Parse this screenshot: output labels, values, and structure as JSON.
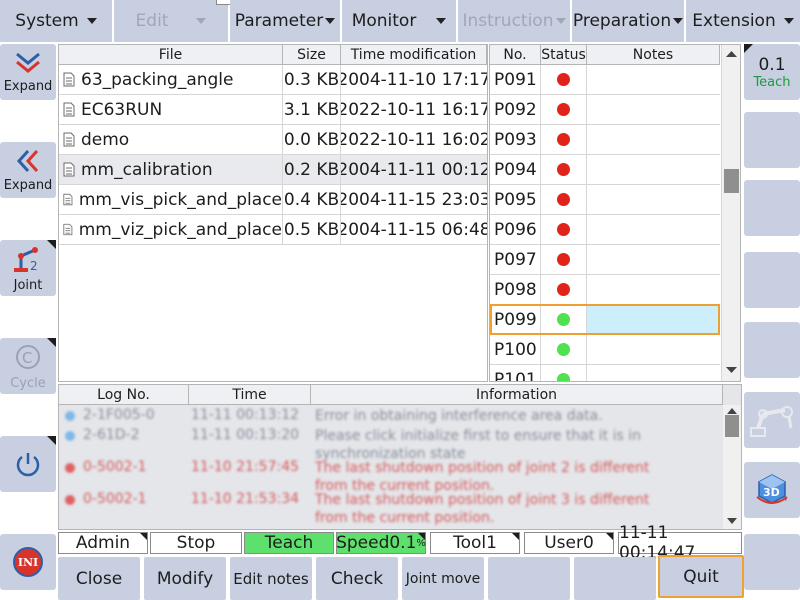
{
  "menu": [
    {
      "label": "System",
      "enabled": true
    },
    {
      "label": "Edit",
      "enabled": false
    },
    {
      "label": "Parameter",
      "enabled": true
    },
    {
      "label": "Monitor",
      "enabled": true
    },
    {
      "label": "Instruction",
      "enabled": false
    },
    {
      "label": "Preparation",
      "enabled": true
    },
    {
      "label": "Extension",
      "enabled": true
    }
  ],
  "left_sidebar": {
    "expand1": "Expand",
    "expand2": "Expand",
    "joint": "Joint",
    "cycle": "Cycle",
    "ini": "INI"
  },
  "files": {
    "headers": {
      "file": "File",
      "size": "Size",
      "time": "Time modification"
    },
    "rows": [
      {
        "name": "63_packing_angle",
        "size": "0.3 KB",
        "time": "2004-11-10 17:17"
      },
      {
        "name": "EC63RUN",
        "size": "3.1 KB",
        "time": "2022-10-11 16:17"
      },
      {
        "name": "demo",
        "size": "0.0 KB",
        "time": "2022-10-11 16:02"
      },
      {
        "name": "mm_calibration",
        "size": "0.2 KB",
        "time": "2004-11-11 00:12"
      },
      {
        "name": "mm_vis_pick_and_place",
        "size": "0.4 KB",
        "time": "2004-11-15 23:03"
      },
      {
        "name": "mm_viz_pick_and_place",
        "size": "0.5 KB",
        "time": "2004-11-15 06:48"
      }
    ]
  },
  "points": {
    "headers": {
      "no": "No.",
      "status": "Status",
      "notes": "Notes"
    },
    "rows": [
      {
        "no": "P091",
        "status": "red"
      },
      {
        "no": "P092",
        "status": "red"
      },
      {
        "no": "P093",
        "status": "red"
      },
      {
        "no": "P094",
        "status": "red"
      },
      {
        "no": "P095",
        "status": "red"
      },
      {
        "no": "P096",
        "status": "red"
      },
      {
        "no": "P097",
        "status": "red"
      },
      {
        "no": "P098",
        "status": "red"
      },
      {
        "no": "P099",
        "status": "green"
      },
      {
        "no": "P100",
        "status": "green"
      },
      {
        "no": "P101",
        "status": "green"
      }
    ],
    "colors": {
      "red": "#e0231b",
      "green": "#4fe14f"
    }
  },
  "log": {
    "headers": {
      "no": "Log No.",
      "time": "Time",
      "info": "Information"
    },
    "rows": [
      {
        "no": "2-1F005-0",
        "time": "11-11 00:13:12",
        "info": "Error in obtaining interference area data.",
        "kind": "info"
      },
      {
        "no": "2-61D-2",
        "time": "11-11 00:13:20",
        "info": "Please click initialize first to ensure that it is in synchronization state",
        "kind": "info"
      },
      {
        "no": "0-5002-1",
        "time": "11-10 21:57:45",
        "info": "The last shutdown position of joint 2 is different from the current position.",
        "kind": "error"
      },
      {
        "no": "0-5002-1",
        "time": "11-10 21:53:34",
        "info": "The last shutdown position of joint 3 is different from the current position.",
        "kind": "error"
      }
    ]
  },
  "status_bar": {
    "user": "Admin",
    "state": "Stop",
    "mode": "Teach",
    "speed": "Speed0.1",
    "speed_sup": "%",
    "tool": "Tool1",
    "userframe": "User0",
    "clock": "11-11 00:14:47"
  },
  "bottom": {
    "close": "Close",
    "modify": "Modify",
    "edit_notes": "Edit notes",
    "check": "Check",
    "joint_move": "Joint move",
    "quit": "Quit"
  },
  "right_sidebar": {
    "teach_value": "0.1",
    "teach_label": "Teach"
  }
}
